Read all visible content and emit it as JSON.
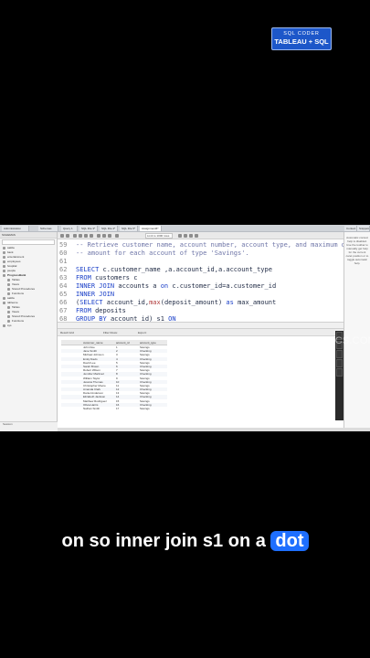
{
  "badge": {
    "line1": "SQL CODER",
    "line2": "TABLEAU + SQL"
  },
  "tabs": [
    {
      "label": "Administration"
    },
    {
      "label": "Schemas"
    },
    {
      "label": "Query 1"
    },
    {
      "label": "SQL File 3*"
    },
    {
      "label": "SQL File 4*"
    },
    {
      "label": "SQL File 5*"
    },
    {
      "label": "Assignment6*"
    },
    {
      "label": "Context"
    },
    {
      "label": "Snippets"
    }
  ],
  "sidebar": {
    "header": "SCHEMAS",
    "items": [
      {
        "label": "sakila",
        "bold": false
      },
      {
        "label": "bank",
        "bold": false
      },
      {
        "label": "entertainment",
        "bold": false
      },
      {
        "label": "employees",
        "bold": false
      },
      {
        "label": "hospital",
        "bold": false
      },
      {
        "label": "people",
        "bold": false
      },
      {
        "label": "ProgressBank",
        "bold": true
      },
      {
        "label": "Tables",
        "bold": false
      },
      {
        "label": "Views",
        "bold": false
      },
      {
        "label": "Stored Procedures",
        "bold": false
      },
      {
        "label": "Functions",
        "bold": false
      },
      {
        "label": "sakila",
        "bold": false
      },
      {
        "label": "tableone",
        "bold": false
      },
      {
        "label": "Tables",
        "bold": false
      },
      {
        "label": "Views",
        "bold": false
      },
      {
        "label": "Stored Procedures",
        "bold": false
      },
      {
        "label": "Functions",
        "bold": false
      },
      {
        "label": "sys",
        "bold": false
      }
    ],
    "footer": "Session"
  },
  "toolbar": {
    "limit_text": "Limit to 1000 rows"
  },
  "editor": {
    "lines": [
      {
        "num": "59",
        "tokens": [
          {
            "t": "-- Retrieve customer name, account number, account type, and maximum deposit",
            "c": "cm"
          }
        ]
      },
      {
        "num": "60",
        "tokens": [
          {
            "t": "-- amount for each account of type 'Savings'.",
            "c": "cm"
          }
        ]
      },
      {
        "num": "61",
        "tokens": []
      },
      {
        "num": "62",
        "tokens": [
          {
            "t": "SELECT ",
            "c": "kw"
          },
          {
            "t": "c.customer_name ,a.account_id,a.account_type",
            "c": "tx"
          }
        ]
      },
      {
        "num": "63",
        "tokens": [
          {
            "t": "FROM ",
            "c": "kw"
          },
          {
            "t": "customers c",
            "c": "tx"
          }
        ]
      },
      {
        "num": "64",
        "tokens": [
          {
            "t": "INNER JOIN ",
            "c": "kw"
          },
          {
            "t": "accounts a ",
            "c": "tx"
          },
          {
            "t": "on ",
            "c": "kw"
          },
          {
            "t": "c.customer_id=a.customer_id",
            "c": "tx"
          }
        ]
      },
      {
        "num": "65",
        "tokens": [
          {
            "t": "INNER JOIN",
            "c": "kw"
          }
        ]
      },
      {
        "num": "66",
        "tokens": [
          {
            "t": "(",
            "c": "tx"
          },
          {
            "t": "SELECT ",
            "c": "kw"
          },
          {
            "t": "account_id,",
            "c": "tx"
          },
          {
            "t": "max",
            "c": "fn"
          },
          {
            "t": "(deposit_amount) ",
            "c": "tx"
          },
          {
            "t": "as ",
            "c": "kw"
          },
          {
            "t": "max_amount",
            "c": "tx"
          }
        ]
      },
      {
        "num": "67",
        "tokens": [
          {
            "t": "FROM ",
            "c": "kw"
          },
          {
            "t": "deposits",
            "c": "tx"
          }
        ]
      },
      {
        "num": "68",
        "tokens": [
          {
            "t": "GROUP BY ",
            "c": "kw"
          },
          {
            "t": "account_id) s1 ",
            "c": "tx"
          },
          {
            "t": "ON",
            "c": "kw"
          }
        ]
      }
    ]
  },
  "results": {
    "toolbar": {
      "grid_label": "Result Grid",
      "filter_label": "Filter Rows:",
      "export_label": "Export:"
    },
    "columns": [
      "",
      "customer_name",
      "account_id",
      "account_type"
    ],
    "rows": [
      [
        "",
        "John Doe",
        "1",
        "Savings"
      ],
      [
        "",
        "Jane Smith",
        "2",
        "Checking"
      ],
      [
        "",
        "Michael Johnson",
        "3",
        "Savings"
      ],
      [
        "",
        "Emily Davis",
        "4",
        "Checking"
      ],
      [
        "",
        "David Lee",
        "5",
        "Savings"
      ],
      [
        "",
        "Sarah Brown",
        "6",
        "Checking"
      ],
      [
        "",
        "Robert Wilson",
        "7",
        "Savings"
      ],
      [
        "",
        "Jennifer Martinez",
        "8",
        "Checking"
      ],
      [
        "",
        "William Taylor",
        "9",
        "Savings"
      ],
      [
        "",
        "Jessica Thomas",
        "10",
        "Checking"
      ],
      [
        "",
        "Christopher Moore",
        "11",
        "Savings"
      ],
      [
        "",
        "Amanda Clark",
        "12",
        "Checking"
      ],
      [
        "",
        "Daniel Anderson",
        "13",
        "Savings"
      ],
      [
        "",
        "Elizabeth Jackson",
        "14",
        "Checking"
      ],
      [
        "",
        "Matthew Rodriguez",
        "15",
        "Savings"
      ],
      [
        "",
        "Olivia Harris",
        "16",
        "Checking"
      ],
      [
        "",
        "Nathan Smith",
        "17",
        "Savings"
      ]
    ]
  },
  "right_panel": {
    "help_text": "Automatic context help is disabled. Use the toolbar to manually get help for the current caret position or to toggle automatic help."
  },
  "watermark": "VISIONFORANALYTICS.COM",
  "caption": {
    "before": "on so inner join s1 on a ",
    "highlight": "dot"
  }
}
